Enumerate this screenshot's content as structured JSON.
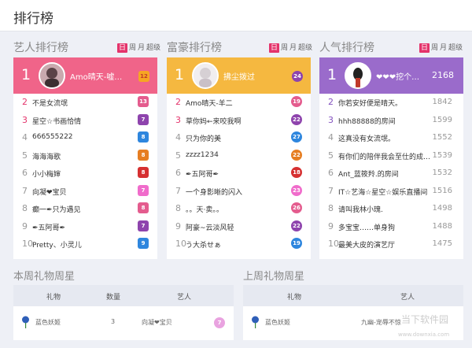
{
  "page": {
    "title": "排行榜"
  },
  "periods": {
    "day": "日",
    "week": "周",
    "month": "月",
    "super": "超级"
  },
  "colors": {
    "artist": "#f06489",
    "rich": "#f5b840",
    "popular": "#9a6bcb",
    "hot_rank": "#e4336b",
    "purple_rank": "#8352bf"
  },
  "boards": {
    "artist": {
      "title": "艺人排行榜",
      "top": {
        "rank": "1",
        "name": "Amo晴天-嘘…",
        "badge": "12"
      },
      "rows": [
        {
          "rank": "2",
          "name": "不是女流氓",
          "badge": "13"
        },
        {
          "rank": "3",
          "name": "星空☆书画恰情",
          "badge": "7"
        },
        {
          "rank": "4",
          "name": "666555222",
          "badge": "8"
        },
        {
          "rank": "5",
          "name": "海海海歌",
          "badge": "8"
        },
        {
          "rank": "6",
          "name": "小小梅婶",
          "badge": "8"
        },
        {
          "rank": "7",
          "name": "向凝❤宝贝",
          "badge": "7"
        },
        {
          "rank": "8",
          "name": "癫一✒只为遇见",
          "badge": "8"
        },
        {
          "rank": "9",
          "name": "✒五阿哥✒",
          "badge": "7"
        },
        {
          "rank": "10",
          "name": "Pretty、小灵儿",
          "badge": "9"
        }
      ]
    },
    "rich": {
      "title": "富豪排行榜",
      "top": {
        "rank": "1",
        "name": "拂尘拨过",
        "badge": "24"
      },
      "rows": [
        {
          "rank": "2",
          "name": "Amo晴天-羊二",
          "badge": "19"
        },
        {
          "rank": "3",
          "name": "草你妈←来咬我啊",
          "badge": "22"
        },
        {
          "rank": "4",
          "name": "只为你的美",
          "badge": "27"
        },
        {
          "rank": "5",
          "name": "zzzz1234",
          "badge": "22"
        },
        {
          "rank": "6",
          "name": "✒五阿哥✒",
          "badge": "18"
        },
        {
          "rank": "7",
          "name": "一个身影晰的闪入",
          "badge": "23"
        },
        {
          "rank": "8",
          "name": "。。天·卖。。",
          "badge": "26"
        },
        {
          "rank": "9",
          "name": "阿豪~云淡风轻",
          "badge": "22"
        },
        {
          "rank": "10",
          "name": "う大杀せぁ",
          "badge": "19"
        }
      ]
    },
    "popular": {
      "title": "人气排行榜",
      "top": {
        "rank": "1",
        "name": "❤❤❤挖个…",
        "value": "2168"
      },
      "rows": [
        {
          "rank": "2",
          "name": "你若安好便是晴天。",
          "value": "1842"
        },
        {
          "rank": "3",
          "name": "hhh88888的房间",
          "value": "1599"
        },
        {
          "rank": "4",
          "name": "这真没有女流氓。",
          "value": "1552"
        },
        {
          "rank": "5",
          "name": "有你们的陪伴我会至仕的成…",
          "value": "1539"
        },
        {
          "rank": "6",
          "name": "Ant_蓝筱羚.的房间",
          "value": "1532"
        },
        {
          "rank": "7",
          "name": "IT☆艺海☆星空☆娱乐直播间",
          "value": "1516"
        },
        {
          "rank": "8",
          "name": "请叫我林小瑰.",
          "value": "1498"
        },
        {
          "rank": "9",
          "name": "多宝宝……单身狗",
          "value": "1488"
        },
        {
          "rank": "10",
          "name": "最美大皮的演艺厅",
          "value": "1475"
        }
      ]
    }
  },
  "gifts": {
    "this_week": {
      "title": "本周礼物周星",
      "headers": {
        "gift": "礼物",
        "count": "数量",
        "artist": "艺人"
      },
      "row": {
        "gift": "蓝色妖姬",
        "count": "3",
        "artist": "向凝❤宝贝",
        "badge": "7"
      }
    },
    "last_week": {
      "title": "上周礼物周星",
      "headers": {
        "gift": "礼物",
        "artist": "艺人"
      },
      "row": {
        "gift": "蓝色妖姬",
        "artist": "九幽-宠辱不惊"
      }
    }
  },
  "watermark": {
    "main": "当下软件园",
    "sub": "www.downxia.com"
  }
}
